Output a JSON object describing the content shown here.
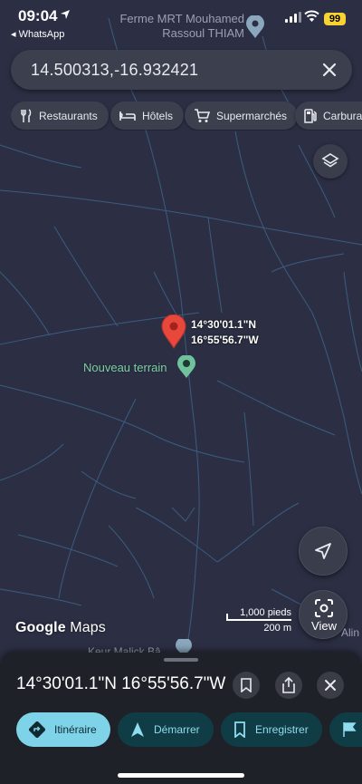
{
  "status_bar": {
    "time": "09:04",
    "back_app": "◂ WhatsApp",
    "battery": "99"
  },
  "map": {
    "top_place": "Ferme MRT Mouhamed Rassoul THIAM",
    "pin_coords_lat": "14°30'01.1\"N",
    "pin_coords_lon": "16°55'56.7\"W",
    "saved_place": "Nouveau terrain",
    "bottom_place": "Keur Malick Bâ",
    "edge_place": "Alin",
    "scale_feet": "1,000 pieds",
    "scale_meters": "200 m",
    "brand_google": "Google",
    "brand_maps": "Maps",
    "view_label": "View",
    "colors": {
      "pin_red": "#e8473c",
      "saved_green": "#7ccfa3",
      "road": "#4a7aa0"
    }
  },
  "search": {
    "value": "14.500313,-16.932421"
  },
  "chips": [
    {
      "label": "Restaurants",
      "icon": "fork-knife-icon"
    },
    {
      "label": "Hôtels",
      "icon": "bed-icon"
    },
    {
      "label": "Supermarchés",
      "icon": "cart-icon"
    },
    {
      "label": "Carburant",
      "icon": "fuel-icon"
    }
  ],
  "sheet": {
    "title": "14°30'01.1\"N 16°55'56.7\"W",
    "actions": [
      {
        "label": "Itinéraire",
        "icon": "directions-icon"
      },
      {
        "label": "Démarrer",
        "icon": "navigation-arrow-icon"
      },
      {
        "label": "Enregistrer",
        "icon": "bookmark-icon"
      },
      {
        "label": "",
        "icon": "flag-icon"
      }
    ]
  }
}
